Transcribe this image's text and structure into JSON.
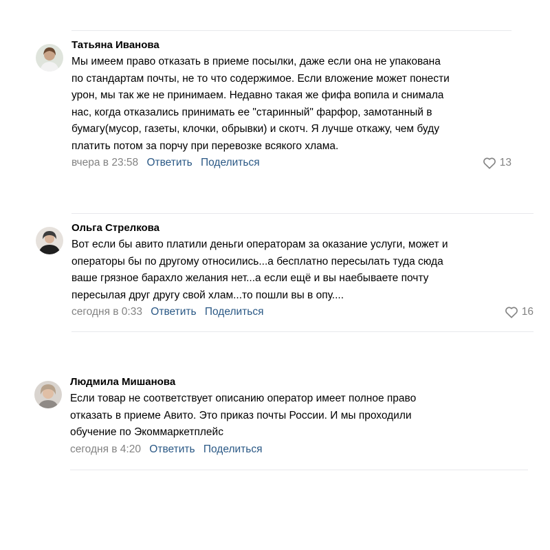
{
  "comments": [
    {
      "author": "Татьяна Иванова",
      "text_lines": [
        "Мы имеем право отказать в приеме посылки, даже если она не упакована",
        "по стандартам почты, не то что содержимое. Если вложение может понести",
        "урон, мы так же не принимаем. Недавно такая же фифа вопила и снимала",
        "нас, когда отказались принимать ее \"старинный\" фарфор, замотанный в",
        "бумагу(мусор, газеты, клочки, обрывки) и скотч. Я лучше откажу, чем буду",
        "платить потом за порчу при перевозке всякого хлама."
      ],
      "time": "вчера в 23:58",
      "reply_label": "Ответить",
      "share_label": "Поделиться",
      "likes": "13"
    },
    {
      "author": "Ольга Стрелкова",
      "text_lines": [
        "Вот если бы авито платили деньги операторам за оказание услуги, может и",
        "операторы бы по другому относились...а бесплатно пересылать туда сюда",
        "ваше грязное барахло желания нет...а если ещё и вы наебываете почту",
        "пересылая друг другу свой хлам...то пошли вы в опу...."
      ],
      "time": "сегодня в 0:33",
      "reply_label": "Ответить",
      "share_label": "Поделиться",
      "likes": "16"
    },
    {
      "author": "Людмила Мишанова",
      "text_lines": [
        "Если товар не соответствует описанию оператор имеет полное право",
        "отказать в приеме Авито. Это приказ почты России. И мы проходили",
        "обучение по Экоммаркетплейс"
      ],
      "time": "сегодня в 4:20",
      "reply_label": "Ответить",
      "share_label": "Поделиться"
    }
  ],
  "icons": {
    "like": "heart-outline-icon"
  },
  "colors": {
    "link": "#2a5885",
    "meta": "#828282",
    "divider": "#e7e8ec"
  }
}
